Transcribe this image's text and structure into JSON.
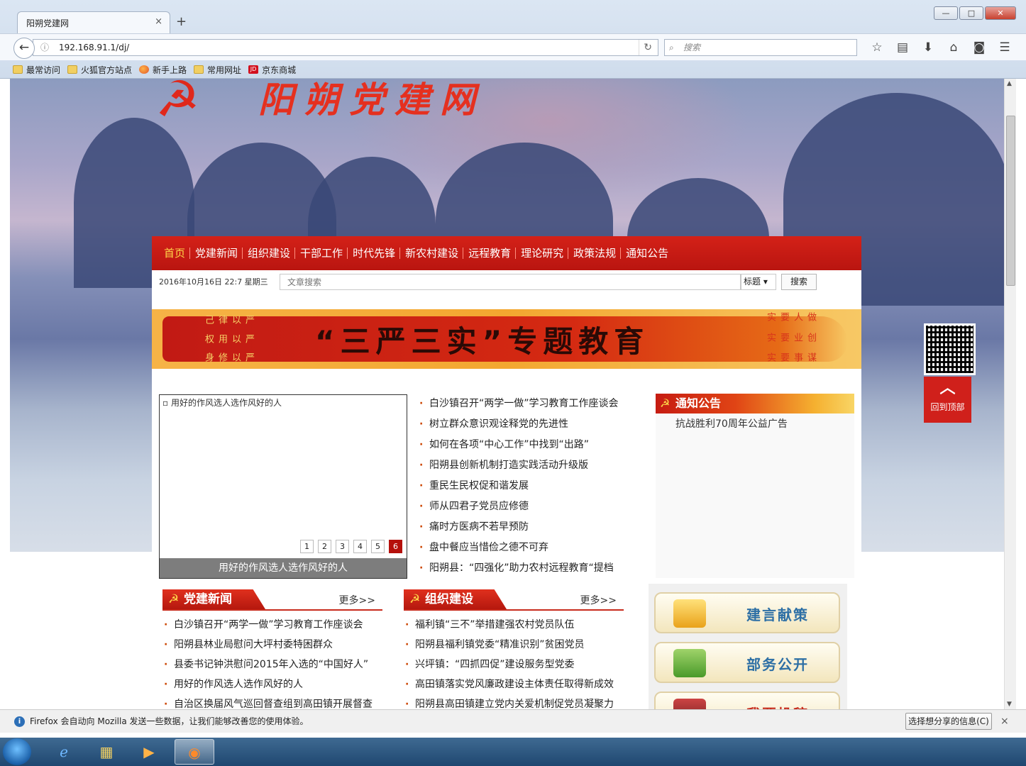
{
  "browser": {
    "tab_title": "阳朔党建网",
    "tab_close": "×",
    "new_tab": "+",
    "url": "192.168.91.1/dj/",
    "search_placeholder": "搜索",
    "window_buttons": {
      "min": "—",
      "max": "□",
      "close": "✕"
    },
    "bookmarks": [
      {
        "label": "最常访问",
        "icon": "folder-icon"
      },
      {
        "label": "火狐官方站点",
        "icon": "folder-icon"
      },
      {
        "label": "新手上路",
        "icon": "firefox-icon"
      },
      {
        "label": "常用网址",
        "icon": "folder-icon"
      },
      {
        "label": "京东商城",
        "icon": "jd-icon"
      }
    ]
  },
  "site": {
    "logo_text": "阳朔党建网",
    "menu": [
      "首页",
      "党建新闻",
      "组织建设",
      "干部工作",
      "时代先锋",
      "新农村建设",
      "远程教育",
      "理论研究",
      "政策法规",
      "通知公告"
    ],
    "date": "2016年10月16日  22:7  星期三",
    "search_placeholder": "文章搜索",
    "search_select": "标题",
    "search_button": "搜索",
    "banner": {
      "title": "“三严三实”专题教育",
      "left_cols": [
        "严以修身",
        "严以用权",
        "严以律己"
      ],
      "right_cols": [
        "谋事要实",
        "创业要实",
        "做人要实"
      ]
    },
    "slider": {
      "image_alt": "用好的作风选人选作风好的人",
      "caption": "用好的作风选人选作风好的人",
      "pages": [
        "1",
        "2",
        "3",
        "4",
        "5",
        "6"
      ],
      "active_page": "6"
    },
    "top_news": [
      "白沙镇召开“两学一做”学习教育工作座谈会",
      "树立群众意识观诠释党的先进性",
      "如何在各项“中心工作”中找到“出路”",
      "阳朔县创新机制打造实践活动升级版",
      "重民生民权促和谐发展",
      "师从四君子党员应修德",
      "痛时方医病不若早预防",
      "盘中餐应当惜俭之德不可弃",
      "阳朔县：“四强化”助力农村远程教育“提档"
    ],
    "notice": {
      "title": "通知公告",
      "items": [
        "抗战胜利70周年公益广告"
      ]
    },
    "sections": [
      {
        "title": "党建新闻",
        "more": "更多>>",
        "items": [
          "白沙镇召开“两学一做”学习教育工作座谈会",
          "阳朔县林业局慰问大坪村委特困群众",
          "县委书记钟洪慰问2015年入选的“中国好人”",
          "用好的作风选人选作风好的人",
          "自治区换届风气巡回督查组到高田镇开展督查"
        ]
      },
      {
        "title": "组织建设",
        "more": "更多>>",
        "items": [
          "福利镇“三不”举措建强农村党员队伍",
          "阳朔县福利镇党委“精准识别”贫困党员",
          "兴坪镇：“四抓四促”建设服务型党委",
          "高田镇落实党风廉政建设主体责任取得新成效",
          "阳朔县高田镇建立党内关爱机制促党员凝聚力"
        ]
      }
    ],
    "right_buttons": [
      "建言献策",
      "部务公开",
      "我要投稿"
    ],
    "to_top": "回到顶部"
  },
  "notification": {
    "text": "Firefox 会自动向 Mozilla 发送一些数据，让我们能够改善您的使用体验。",
    "share_button": "选择想分享的信息(C)",
    "close": "×"
  },
  "taskbar": [
    "start-orb",
    "ie-icon",
    "explorer-icon",
    "media-player-icon",
    "firefox-icon"
  ]
}
